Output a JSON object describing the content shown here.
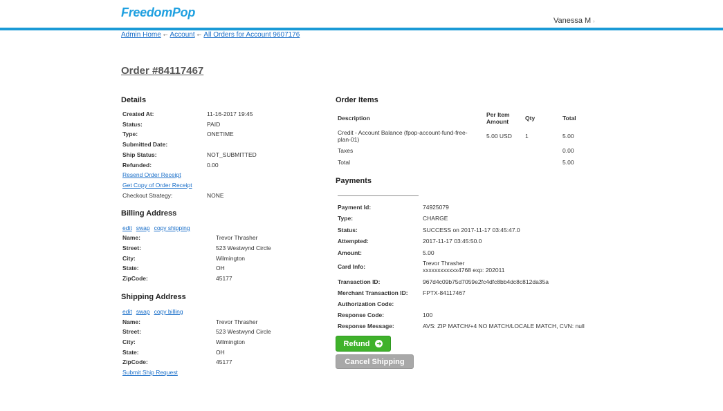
{
  "header": {
    "logo": "FreedomPop",
    "user": "Vanessa M",
    "user_caret": "›"
  },
  "breadcrumb": {
    "items": [
      "Admin Home",
      "Account",
      "All Orders for Account 9607176"
    ],
    "sep": "⇽"
  },
  "order": {
    "title": "Order #84117467"
  },
  "details": {
    "heading": "Details",
    "created_at_label": "Created At:",
    "created_at": "11-16-2017 19:45",
    "status_label": "Status:",
    "status": "PAID",
    "type_label": "Type:",
    "type": "ONETIME",
    "submitted_label": "Submitted Date:",
    "submitted": "",
    "ship_status_label": "Ship Status:",
    "ship_status": "NOT_SUBMITTED",
    "refunded_label": "Refunded:",
    "refunded": "0.00",
    "resend_receipt": "Resend Order Receipt",
    "copy_receipt": "Get Copy of Order Receipt",
    "checkout_label": "Checkout Strategy:",
    "checkout": "NONE"
  },
  "billing": {
    "heading": "Billing Address",
    "edit": "edit",
    "swap": "swap",
    "copy": "copy shipping",
    "name_label": "Name:",
    "name": "Trevor Thrasher",
    "street_label": "Street:",
    "street": "523 Westwynd Circle",
    "city_label": "City:",
    "city": "Wilmington",
    "state_label": "State:",
    "state": "OH",
    "zip_label": "ZipCode:",
    "zip": "45177"
  },
  "shipping": {
    "heading": "Shipping Address",
    "edit": "edit",
    "swap": "swap",
    "copy": "copy billing",
    "name_label": "Name:",
    "name": "Trevor Thrasher",
    "street_label": "Street:",
    "street": "523 Westwynd Circle",
    "city_label": "City:",
    "city": "Wilmington",
    "state_label": "State:",
    "state": "OH",
    "zip_label": "ZipCode:",
    "zip": "45177",
    "submit_request": "Submit Ship Request"
  },
  "items": {
    "heading": "Order Items",
    "col_description": "Description",
    "col_price_1": "Per Item",
    "col_price_2": "Amount",
    "col_qty": "Qty",
    "col_total": "Total",
    "row1_desc_1": "Credit - Account Balance (fpop-account-fund-free-",
    "row1_desc_2": "plan-01)",
    "row1_price": "5.00 USD",
    "row1_qty": "1",
    "row1_total": "5.00",
    "taxes_label": "Taxes",
    "taxes": "0.00",
    "total_label": "Total",
    "total": "5.00"
  },
  "payments": {
    "heading": "Payments",
    "payment_id_label": "Payment Id:",
    "payment_id": "74925079",
    "type_label": "Type:",
    "type": "CHARGE",
    "status_label": "Status:",
    "status": "SUCCESS on 2017-11-17 03:45:47.0",
    "attempted_label": "Attempted:",
    "attempted": "2017-11-17 03:45:50.0",
    "amount_label": "Amount:",
    "amount": "5.00",
    "card_label": "Card Info:",
    "card_name": "Trevor Thrasher",
    "card_number": "xxxxxxxxxxxx4768 exp: 202011",
    "txn_label": "Transaction ID:",
    "txn": "967d4c09b75d7059e2fc4dfc8bb4dc8c812da35a",
    "merchant_label": "Merchant Transaction ID:",
    "merchant": "FPTX-84117467",
    "auth_label": "Authorization Code:",
    "auth": "",
    "resp_code_label": "Response Code:",
    "resp_code": "100",
    "resp_msg_label": "Response Message:",
    "resp_msg": "AVS: ZIP MATCH/+4 NO MATCH/LOCALE MATCH, CVN: null"
  },
  "actions": {
    "refund": "Refund",
    "refund_icon": "➔",
    "cancel_shipping": "Cancel Shipping"
  },
  "colors": {
    "brand": "#1fa0e0",
    "topbar": "#1a9ad6",
    "link": "#1a6fc9",
    "refund": "#3fb22b",
    "cancel": "#a8a8a8"
  }
}
